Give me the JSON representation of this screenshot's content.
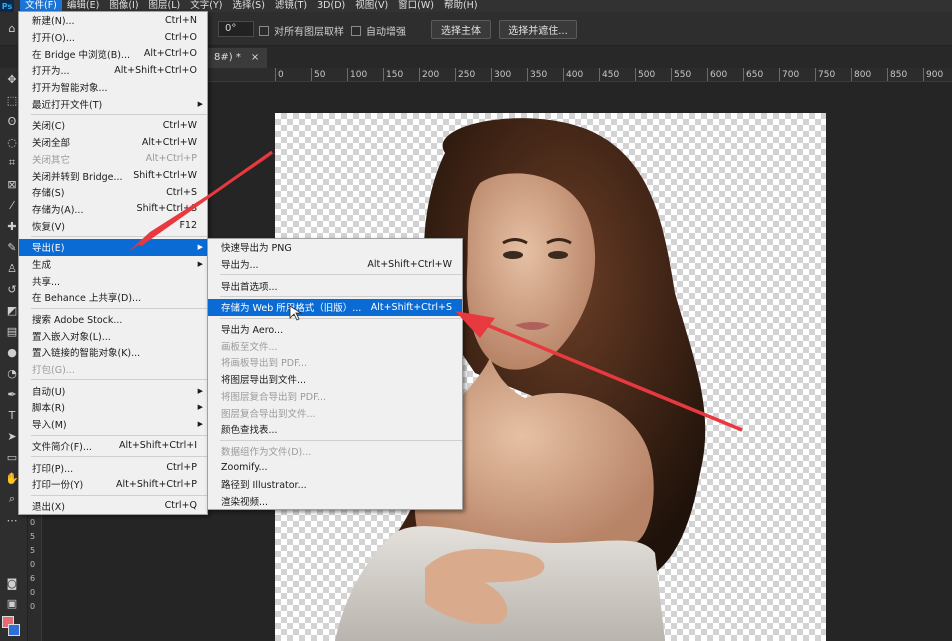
{
  "menubar": {
    "logo": "Ps",
    "items": [
      "文件(F)",
      "编辑(E)",
      "图像(I)",
      "图层(L)",
      "文字(Y)",
      "选择(S)",
      "滤镜(T)",
      "3D(D)",
      "视图(V)",
      "窗口(W)",
      "帮助(H)"
    ]
  },
  "options": {
    "angle_value": "0°",
    "sample_all_layers": "对所有图层取样",
    "auto_enhance": "自动增强",
    "select_subject": "选择主体",
    "select_and_mask": "选择并遮住..."
  },
  "tab": {
    "title": "8#) *",
    "close": "×"
  },
  "ruler": {
    "h_labels": [
      "0",
      "50",
      "100",
      "150",
      "200",
      "250",
      "300",
      "350",
      "400",
      "450",
      "500",
      "550",
      "600",
      "650",
      "700",
      "750",
      "800",
      "850",
      "900"
    ],
    "v_labels": [
      "5",
      "0",
      "5",
      "5",
      "0",
      "6",
      "0",
      "0"
    ]
  },
  "file_menu": [
    {
      "label": "新建(N)...",
      "shortcut": "Ctrl+N"
    },
    {
      "label": "打开(O)...",
      "shortcut": "Ctrl+O"
    },
    {
      "label": "在 Bridge 中浏览(B)...",
      "shortcut": "Alt+Ctrl+O"
    },
    {
      "label": "打开为...",
      "shortcut": "Alt+Shift+Ctrl+O"
    },
    {
      "label": "打开为智能对象...",
      "shortcut": ""
    },
    {
      "label": "最近打开文件(T)",
      "shortcut": "",
      "arrow": true
    },
    {
      "sep": true
    },
    {
      "label": "关闭(C)",
      "shortcut": "Ctrl+W"
    },
    {
      "label": "关闭全部",
      "shortcut": "Alt+Ctrl+W"
    },
    {
      "label": "关闭其它",
      "shortcut": "Alt+Ctrl+P",
      "disabled": true
    },
    {
      "label": "关闭并转到 Bridge...",
      "shortcut": "Shift+Ctrl+W"
    },
    {
      "label": "存储(S)",
      "shortcut": "Ctrl+S"
    },
    {
      "label": "存储为(A)...",
      "shortcut": "Shift+Ctrl+S"
    },
    {
      "label": "恢复(V)",
      "shortcut": "F12"
    },
    {
      "sep": true
    },
    {
      "label": "导出(E)",
      "shortcut": "",
      "arrow": true,
      "highlight": true
    },
    {
      "label": "生成",
      "shortcut": "",
      "arrow": true
    },
    {
      "label": "共享...",
      "shortcut": ""
    },
    {
      "label": "在 Behance 上共享(D)...",
      "shortcut": ""
    },
    {
      "sep": true
    },
    {
      "label": "搜索 Adobe Stock...",
      "shortcut": ""
    },
    {
      "label": "置入嵌入对象(L)...",
      "shortcut": ""
    },
    {
      "label": "置入链接的智能对象(K)...",
      "shortcut": ""
    },
    {
      "label": "打包(G)...",
      "shortcut": "",
      "disabled": true
    },
    {
      "sep": true
    },
    {
      "label": "自动(U)",
      "shortcut": "",
      "arrow": true
    },
    {
      "label": "脚本(R)",
      "shortcut": "",
      "arrow": true
    },
    {
      "label": "导入(M)",
      "shortcut": "",
      "arrow": true
    },
    {
      "sep": true
    },
    {
      "label": "文件简介(F)...",
      "shortcut": "Alt+Shift+Ctrl+I"
    },
    {
      "sep": true
    },
    {
      "label": "打印(P)...",
      "shortcut": "Ctrl+P"
    },
    {
      "label": "打印一份(Y)",
      "shortcut": "Alt+Shift+Ctrl+P"
    },
    {
      "sep": true
    },
    {
      "label": "退出(X)",
      "shortcut": "Ctrl+Q"
    }
  ],
  "export_menu": [
    {
      "label": "快速导出为 PNG",
      "shortcut": ""
    },
    {
      "label": "导出为...",
      "shortcut": "Alt+Shift+Ctrl+W"
    },
    {
      "sep": true
    },
    {
      "label": "导出首选项...",
      "shortcut": ""
    },
    {
      "sep": true
    },
    {
      "label": "存储为 Web 所用格式（旧版）...",
      "shortcut": "Alt+Shift+Ctrl+S",
      "highlight": true
    },
    {
      "sep": true
    },
    {
      "label": "导出为 Aero...",
      "shortcut": ""
    },
    {
      "label": "画板至文件...",
      "shortcut": "",
      "disabled": true
    },
    {
      "label": "将画板导出到 PDF...",
      "shortcut": "",
      "disabled": true
    },
    {
      "label": "将图层导出到文件...",
      "shortcut": ""
    },
    {
      "label": "将图层复合导出到 PDF...",
      "shortcut": "",
      "disabled": true
    },
    {
      "label": "图层复合导出到文件...",
      "shortcut": "",
      "disabled": true
    },
    {
      "label": "颜色查找表...",
      "shortcut": ""
    },
    {
      "sep": true
    },
    {
      "label": "数据组作为文件(D)...",
      "shortcut": "",
      "disabled": true
    },
    {
      "label": "Zoomify...",
      "shortcut": ""
    },
    {
      "label": "路径到 Illustrator...",
      "shortcut": ""
    },
    {
      "label": "渲染视频...",
      "shortcut": ""
    }
  ],
  "colors": {
    "highlight": "#0b6bd4",
    "arrow": "#e8393f",
    "fg_swatch": "#e66a75",
    "bg_swatch": "#2f6fd8"
  }
}
